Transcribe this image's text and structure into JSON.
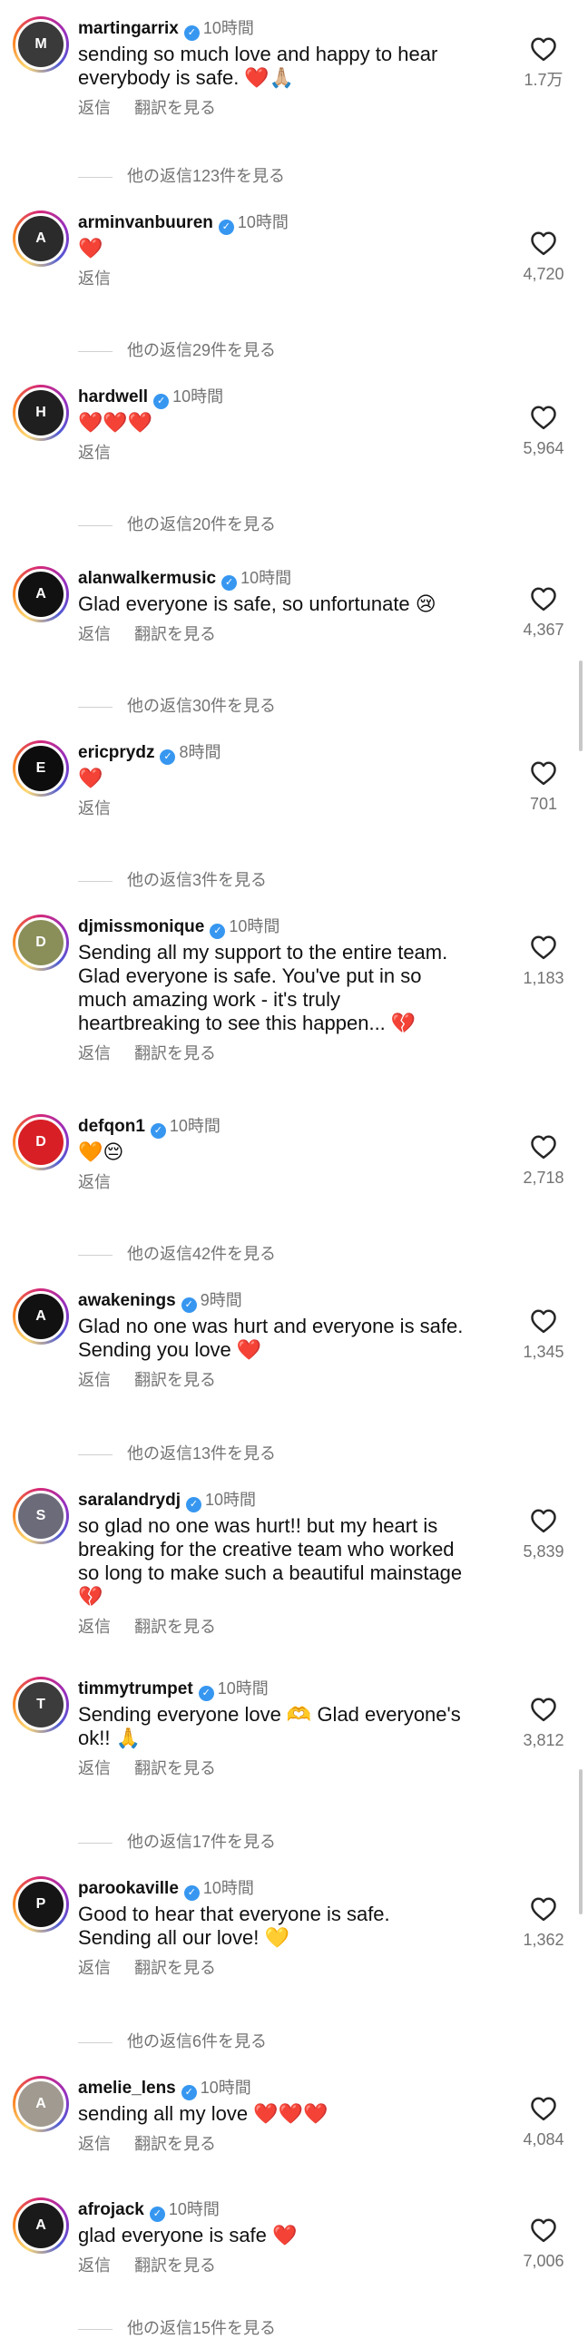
{
  "labels": {
    "reply": "返信",
    "translate": "翻訳を見る"
  },
  "comments": [
    {
      "username": "martingarrix",
      "time": "10時間",
      "text": "sending so much love and happy to hear\neverybody is safe. ❤️🙏🏼",
      "likes": "1.7万",
      "translate": true,
      "view_replies": "他の返信123件を見る",
      "avatar_icon": "martingarrix-avatar",
      "avatar_color": "#3a3a3a"
    },
    {
      "username": "arminvanbuuren",
      "time": "10時間",
      "text": "❤️",
      "likes": "4,720",
      "translate": false,
      "view_replies": "他の返信29件を見る",
      "avatar_icon": "arminvanbuuren-avatar",
      "avatar_color": "#2b2b2b"
    },
    {
      "username": "hardwell",
      "time": "10時間",
      "text": "❤️❤️❤️",
      "likes": "5,964",
      "translate": false,
      "view_replies": "他の返信20件を見る",
      "avatar_icon": "hardwell-avatar",
      "avatar_color": "#1f1f1f"
    },
    {
      "username": "alanwalkermusic",
      "time": "10時間",
      "text": "Glad everyone is safe, so unfortunate 😢",
      "likes": "4,367",
      "translate": true,
      "view_replies": "他の返信30件を見る",
      "avatar_icon": "alanwalker-logo-avatar",
      "avatar_color": "#111111"
    },
    {
      "username": "ericprydz",
      "time": "8時間",
      "text": "❤️",
      "likes": "701",
      "translate": false,
      "view_replies": "他の返信3件を見る",
      "avatar_icon": "ericprydz-avatar",
      "avatar_color": "#0d0d0d"
    },
    {
      "username": "djmissmonique",
      "time": "10時間",
      "text": "Sending all my support to the entire team.\nGlad everyone is safe. You've put in so\nmuch amazing work - it's truly\nheartbreaking to see this happen... 💔",
      "likes": "1,183",
      "translate": true,
      "view_replies": "",
      "avatar_icon": "djmissmonique-avatar",
      "avatar_color": "#8a8f5a"
    },
    {
      "username": "defqon1",
      "time": "10時間",
      "text": "🧡😔",
      "likes": "2,718",
      "translate": false,
      "view_replies": "他の返信42件を見る",
      "avatar_icon": "defqon1-logo-avatar",
      "avatar_color": "#d81f26"
    },
    {
      "username": "awakenings",
      "time": "9時間",
      "text": "Glad no one was hurt and everyone is safe.\nSending you love ❤️",
      "likes": "1,345",
      "translate": true,
      "view_replies": "他の返信13件を見る",
      "avatar_icon": "awakenings-logo-avatar",
      "avatar_color": "#111111"
    },
    {
      "username": "saralandrydj",
      "time": "10時間",
      "text": "so glad no one was hurt!! but my heart is\nbreaking for the creative team who worked\nso long to make such a beautiful mainstage\n💔",
      "likes": "5,839",
      "translate": true,
      "view_replies": "",
      "avatar_icon": "saralandrydj-avatar",
      "avatar_color": "#6b6b7a"
    },
    {
      "username": "timmytrumpet",
      "time": "10時間",
      "text": "Sending everyone love 🫶 Glad everyone's\nok!! 🙏",
      "likes": "3,812",
      "translate": true,
      "view_replies": "他の返信17件を見る",
      "avatar_icon": "timmytrumpet-avatar",
      "avatar_color": "#3c3c3c"
    },
    {
      "username": "parookaville",
      "time": "10時間",
      "text": "Good to hear that everyone is safe.\nSending all our love! 💛",
      "likes": "1,362",
      "translate": true,
      "view_replies": "他の返信6件を見る",
      "avatar_icon": "parookaville-logo-avatar",
      "avatar_color": "#151515"
    },
    {
      "username": "amelie_lens",
      "time": "10時間",
      "text": "sending all my love ❤️❤️❤️",
      "likes": "4,084",
      "translate": true,
      "view_replies": "",
      "avatar_icon": "amelie_lens-avatar",
      "avatar_color": "#a09a90"
    },
    {
      "username": "afrojack",
      "time": "10時間",
      "text": "glad everyone is safe ❤️",
      "likes": "7,006",
      "translate": true,
      "view_replies": "他の返信15件を見る",
      "avatar_icon": "afrojack-avatar",
      "avatar_color": "#1a1a1a"
    }
  ]
}
